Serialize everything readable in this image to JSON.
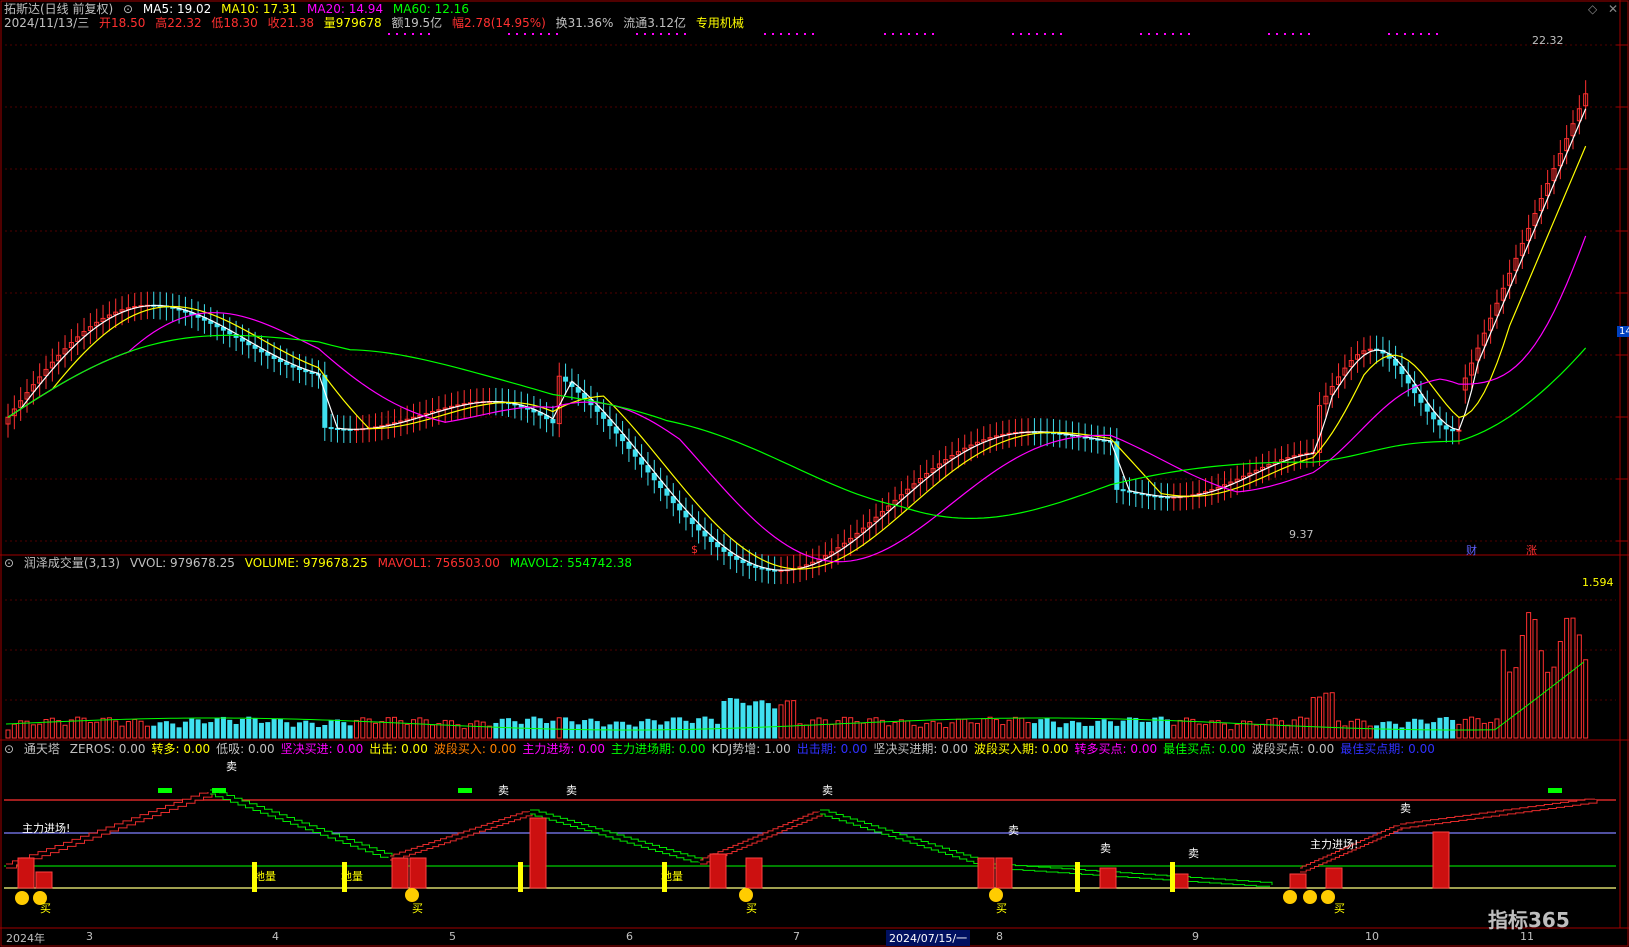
{
  "header": {
    "stock": "拓斯达(日线 前复权)",
    "ma": [
      {
        "label": "MA5: 19.02",
        "color": "#ffffff"
      },
      {
        "label": "MA10: 17.31",
        "color": "#ffff00"
      },
      {
        "label": "MA20: 14.94",
        "color": "#ff00ff"
      },
      {
        "label": "MA60: 12.16",
        "color": "#00ff00"
      }
    ],
    "date": "2024/11/13/三",
    "open": "开18.50",
    "high": "高22.32",
    "low": "低18.30",
    "close": "收21.38",
    "vol": "量979678",
    "amount": "额19.5亿",
    "change": "幅2.78(14.95%)",
    "turnover": "换31.36%",
    "float": "流通3.12亿",
    "sector": "专用机械"
  },
  "price_panel": {
    "high_label": "22.32",
    "low_label": "9.37",
    "right_tag": "14",
    "markers": [
      "$",
      "财",
      "涨"
    ]
  },
  "volume_panel": {
    "title": "润泽成交量(3,13)",
    "items": [
      {
        "label": "VVOL: 979678.25",
        "color": "#c0c0c0"
      },
      {
        "label": "VOLUME: 979678.25",
        "color": "#ffff00"
      },
      {
        "label": "MAVOL1: 756503.00",
        "color": "#ff3030"
      },
      {
        "label": "MAVOL2: 554742.38",
        "color": "#00ff00"
      }
    ],
    "max_label": "1.594"
  },
  "indicator_panel": {
    "title": "通天塔",
    "items": [
      {
        "label": "ZEROS: 0.00",
        "color": "#c0c0c0"
      },
      {
        "label": "转多: 0.00",
        "color": "#ffff00"
      },
      {
        "label": "低吸: 0.00",
        "color": "#c0c0c0"
      },
      {
        "label": "坚决买进: 0.00",
        "color": "#ff00ff"
      },
      {
        "label": "出击: 0.00",
        "color": "#ffff00"
      },
      {
        "label": "波段买入: 0.00",
        "color": "#ff8000"
      },
      {
        "label": "主力进场: 0.00",
        "color": "#ff00ff"
      },
      {
        "label": "主力进场期: 0.00",
        "color": "#00ff00"
      },
      {
        "label": "KDJ势增: 1.00",
        "color": "#c0c0c0"
      },
      {
        "label": "出击期: 0.00",
        "color": "#3030ff"
      },
      {
        "label": "坚决买进期: 0.00",
        "color": "#c0c0c0"
      },
      {
        "label": "波段买入期: 0.00",
        "color": "#ffff00"
      },
      {
        "label": "转多买点: 0.00",
        "color": "#ff00ff"
      },
      {
        "label": "最佳买点: 0.00",
        "color": "#00ff00"
      },
      {
        "label": "波段买点: 0.00",
        "color": "#c0c0c0"
      },
      {
        "label": "最佳买点期: 0.00",
        "color": "#3030ff"
      }
    ],
    "signals": {
      "sell": "卖",
      "buy": "买",
      "main": "主力进场!",
      "dig": "地量"
    }
  },
  "axis": {
    "ticks": [
      "2024年",
      "3",
      "4",
      "5",
      "6",
      "7",
      "2024/07/15/一",
      "8",
      "9",
      "10",
      "11"
    ]
  },
  "watermark": "指标365"
}
